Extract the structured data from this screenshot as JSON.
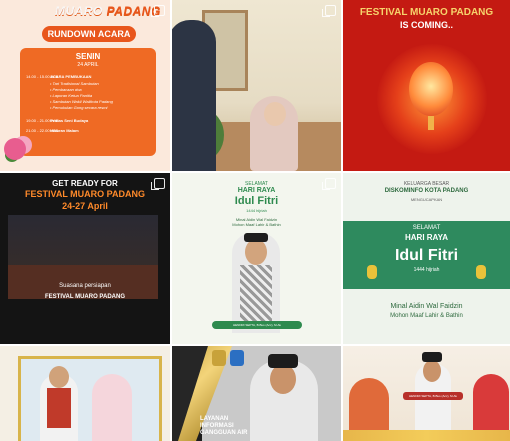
{
  "tiles": [
    {
      "logo_a": "MUARO",
      "logo_b": "PADANG",
      "pill": "RUNDOWN ACARA",
      "day": "SENIN",
      "date": "24 APRIL",
      "rows": [
        {
          "time": "14.00 - 15.00 WIB",
          "text": "ACARA PEMBUKAAN"
        },
        {
          "time": "",
          "text": "• Tari Tradisional Sambutan"
        },
        {
          "time": "",
          "text": "• Pembacaan doa"
        },
        {
          "time": "",
          "text": "• Laporan Ketua Panitia"
        },
        {
          "time": "",
          "text": "• Sambutan Wakil Walikota Padang"
        },
        {
          "time": "",
          "text": "• Pemukulan Gong secara resmi"
        },
        {
          "time": "19.00 - 21.00 WIB",
          "text": "Pentas Seni Budaya"
        },
        {
          "time": "21.00 - 22.00 WIB",
          "text": "Hiburan Malam"
        }
      ]
    },
    {},
    {
      "title": "FESTIVAL MUARO PADANG",
      "sub": "IS COMING.."
    },
    {
      "head1": "GET READY FOR",
      "head2": "FESTIVAL MUARO PADANG",
      "head3": "24-27 April",
      "cap1": "Suasana persiapan",
      "cap2": "FESTIVAL MUARO PADANG"
    },
    {
      "top": "SELAMAT",
      "hr": "HARI RAYA",
      "idul": "Idul Fitri",
      "hijri": "1444 hijriah",
      "m1": "Minal Aidin Wal Faidzin",
      "m2": "Mohon Maaf Lahir & Bathin",
      "name": "HENDRI SEPTA, B.Bus (Acc), M.Ak"
    },
    {
      "k1": "KELUARGA BESAR",
      "k2": "DISKOMINFO KOTA PADANG",
      "k3": "MENGUCAPKAN",
      "s1": "SELAMAT",
      "s2": "HARI RAYA",
      "idul": "Idul Fitri",
      "hj": "1444 hijriah",
      "mw": "Minal Aidin Wal Faidzin",
      "mm": "Mohon Maaf Lahir & Bathin"
    },
    {},
    {
      "l1": "LAYANAN",
      "l2": "INFORMASI",
      "l3": "GANGGUAN AIR"
    },
    {
      "tag": "HENDRI SEPTA, B.Bus (Acc), M.Ak"
    }
  ],
  "colors": {
    "accent_orange": "#e8561c",
    "festival_red": "#c41a12",
    "idul_green": "#2e8a4e",
    "gold": "#d8b44a"
  },
  "icons": {
    "multi_post": "carousel-icon"
  }
}
